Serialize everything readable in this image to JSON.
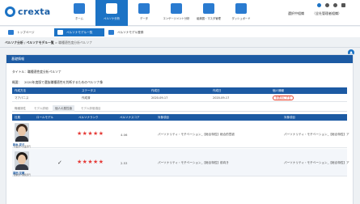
{
  "header": {
    "logo_text": "crexta",
    "nav": [
      {
        "label": "ホーム",
        "icon": "home-icon",
        "color": "#2a7bd0"
      },
      {
        "label": "ペルソナ分析",
        "icon": "persona-icon",
        "color": "#ffffff"
      },
      {
        "label": "データ",
        "icon": "database-icon",
        "color": "#2a7bd0"
      },
      {
        "label": "エンゲージメント分析",
        "icon": "chart-icon",
        "color": "#2a7bd0"
      },
      {
        "label": "組織図・マスタ管理",
        "icon": "org-chart-icon",
        "color": "#2a7bd0"
      },
      {
        "label": "ダッシュボード",
        "icon": "dashboard-icon",
        "color": "#2a7bd0"
      }
    ],
    "tenant_label": "選択中組織",
    "tenant_value": "（全社管理者組織）"
  },
  "subnav": {
    "items": [
      "トップページ",
      "ペルソナモデル一覧",
      "ペルソナモデル登録"
    ],
    "active_index": 1
  },
  "breadcrumb": {
    "first": "ペルソナ分析",
    "sep": "/",
    "second": "ペルソナモデル一覧",
    "arrow": ">",
    "third": "職種適性度分析ペルソナ"
  },
  "card": {
    "title": "基礎情報",
    "title_label": "タイトル：",
    "title_value": "職種適性度分析ペルソナ",
    "summary_label": "概要：",
    "summary_value": "2020年度版で選抜職種適性を判断するためのペルソナ像"
  },
  "info_table": {
    "headers": [
      "作成方法",
      "ステータス",
      "作成日",
      "作成日",
      "個人情報"
    ],
    "row": [
      "マアパニス",
      "作成済",
      "2020-09-17",
      "2020-09-17",
      "非表示にする"
    ]
  },
  "tabs": [
    "職種適性",
    "モデル詳細",
    "個人の属性値",
    "モデル評価項目"
  ],
  "tabs_active_index": 2,
  "table": {
    "headers": [
      "社員",
      "ロールモデル",
      "ペルソナランク",
      "ペルソナスコア",
      "対象項目",
      "対象項目"
    ],
    "rows": [
      {
        "name": "鈴木 花子",
        "sub": "営業部 / 営業部門",
        "role_model": "",
        "stars": "★★★★★",
        "score": "4.06",
        "col1": "パーソナリティ・モチベーション_【総合特性】総合的意欲",
        "col2": "パーソナリティ・モチベーション_【総合特性】ア"
      },
      {
        "name": "高田 友樹",
        "sub": "技術部 / 開発部門",
        "role_model": "✓",
        "stars": "★★★★★",
        "score": "2.53",
        "col1": "パーソナリティ・モチベーション_【総合特性】前向き",
        "col2": "パーソナリティ・モチベーション_【総合特性】ア"
      }
    ]
  }
}
